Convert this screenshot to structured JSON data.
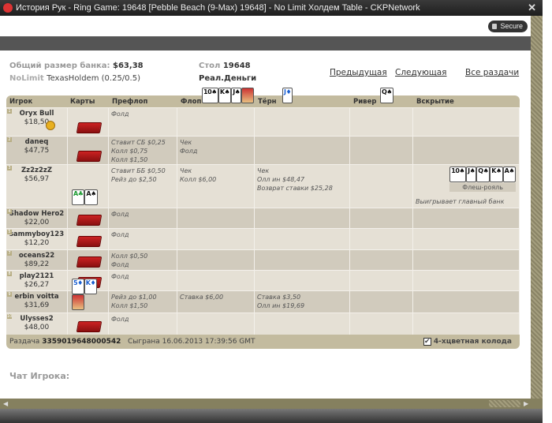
{
  "window": {
    "title": "История Рук - Ring Game: 19648 [Pebble Beach (9-Max) 19648] - No Limit Холдем Table - CKPNetwork",
    "close_icon": "close-icon",
    "secure_label": "Secure"
  },
  "summary": {
    "pot_label": "Общий размер банка:",
    "pot_value": "$63,38",
    "limit_label": "NoLimit",
    "game": "TexasHoldem (0.25/0.5)",
    "table_label": "Стол",
    "table_value": "19648",
    "money": "Реал.Деньги"
  },
  "nav": {
    "prev": "Предыдущая",
    "next": "Следующая",
    "all": "Все раздачи"
  },
  "columns": [
    "Игрок",
    "Карты",
    "Префлоп",
    "Флоп",
    "Тёрн",
    "Ривер",
    "Вскрытие"
  ],
  "board": {
    "flop": [
      "10♠",
      "K♠",
      "J♠"
    ],
    "turn": "J♦",
    "river": "Q♠"
  },
  "players": [
    {
      "seat": "1",
      "name": "Oryx Bull",
      "stack": "$18,50",
      "dealer": true,
      "cards": null,
      "preflop": [
        "Фолд"
      ],
      "flop": [],
      "turn": [],
      "river": [],
      "showdown": []
    },
    {
      "seat": "2",
      "name": "daneq",
      "stack": "$47,75",
      "cards": null,
      "preflop": [
        "Ставит СБ $0,25",
        "Колл $0,75",
        "Колл $1,50"
      ],
      "flop": [
        "Чек",
        "Фолд"
      ],
      "turn": [],
      "river": [],
      "showdown": []
    },
    {
      "seat": "3",
      "name": "Zz2z2zZ",
      "stack": "$56,97",
      "cards": [
        "A♣",
        "A♠"
      ],
      "preflop": [
        "Ставит ББ $0,50",
        "Рейз до $2,50"
      ],
      "flop": [
        "Чек",
        "Колл $6,00"
      ],
      "turn": [
        "Чек",
        "Олл ин $48,47",
        "Возврат ставки $25,28"
      ],
      "river": [],
      "showdown": [
        "Выигрывает главный банк"
      ],
      "best_hand": [
        "10♠",
        "J♠",
        "Q♠",
        "K♠",
        "A♠"
      ],
      "hand_name": "Флеш-рояль"
    },
    {
      "seat": "4",
      "name": "Shadow Hero2",
      "stack": "$22,00",
      "cards": null,
      "preflop": [
        "Фолд"
      ],
      "flop": [],
      "turn": [],
      "river": [],
      "showdown": []
    },
    {
      "seat": "5",
      "name": "sammyboy123",
      "stack": "$12,20",
      "cards": null,
      "preflop": [
        "Фолд"
      ],
      "flop": [],
      "turn": [],
      "river": [],
      "showdown": []
    },
    {
      "seat": "7",
      "name": "oceans22",
      "stack": "$89,22",
      "cards": null,
      "preflop": [
        "Колл $0,50",
        "Фолд"
      ],
      "flop": [],
      "turn": [],
      "river": [],
      "showdown": []
    },
    {
      "seat": "8",
      "name": "play2121",
      "stack": "$26,27",
      "cards": null,
      "preflop": [
        "Фолд"
      ],
      "flop": [],
      "turn": [],
      "river": [],
      "showdown": []
    },
    {
      "seat": "9",
      "name": "erbin voitta",
      "stack": "$31,69",
      "cards": [
        "5♦",
        "K♦"
      ],
      "preflop": [
        "Рейз до $1,00",
        "Колл $1,50"
      ],
      "flop": [
        "Ставка $6,00"
      ],
      "turn": [
        "Ставка $3,50",
        "Олл ин $19,69"
      ],
      "river": [],
      "showdown": []
    },
    {
      "seat": "10",
      "name": "Ulysses2",
      "stack": "$48,00",
      "cards": null,
      "preflop": [
        "Фолд"
      ],
      "flop": [],
      "turn": [],
      "river": [],
      "showdown": []
    }
  ],
  "footer": {
    "hand_label": "Раздача",
    "hand_id": "3359019648000542",
    "played_label": "Сыграна",
    "played": "16.06.2013 17:39:56 GMT",
    "four_color_label": "4-хцветная колода",
    "four_color_checked": true
  },
  "chat": {
    "title": "Чат Игрока:"
  },
  "colors": {
    "header": "#c3bb9f",
    "row_light": "#e5e0d5",
    "row_dark": "#d1cbbd"
  }
}
